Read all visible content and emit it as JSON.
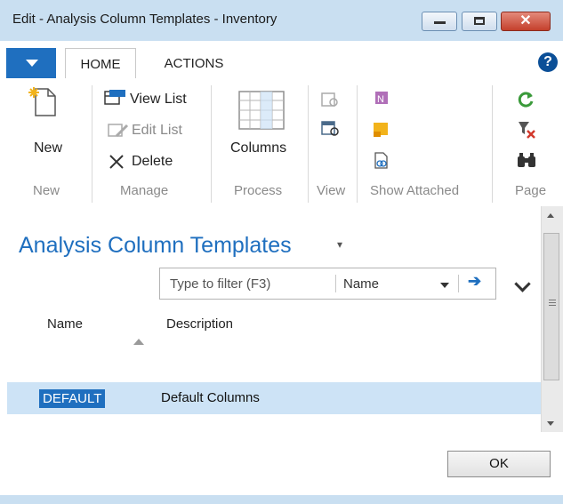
{
  "window": {
    "title": "Edit - Analysis Column Templates - Inventory",
    "close_glyph": "✕"
  },
  "ribbon": {
    "tabs": [
      {
        "label": "HOME",
        "selected": true
      },
      {
        "label": "ACTIONS",
        "selected": false
      }
    ],
    "help_glyph": "?",
    "groups": {
      "new": {
        "label": "New",
        "new_button": "New"
      },
      "manage": {
        "label": "Manage",
        "view_list": "View List",
        "edit_list": "Edit List",
        "delete": "Delete"
      },
      "process": {
        "label": "Process",
        "columns": "Columns"
      },
      "view": {
        "label": "View"
      },
      "show_attached": {
        "label": "Show Attached"
      },
      "page": {
        "label": "Page"
      }
    }
  },
  "page": {
    "title": "Analysis Column Templates",
    "title_arrow": "▾",
    "filter": {
      "placeholder": "Type to filter (F3)",
      "field": "Name",
      "go_glyph": "➔"
    },
    "columns": [
      "Name",
      "Description"
    ],
    "rows": [
      {
        "name": "DEFAULT",
        "description": "Default Columns",
        "selected": true
      }
    ]
  },
  "footer": {
    "ok_label": "OK"
  },
  "colors": {
    "accent": "#1f6fbf",
    "title_bar": "#c9dff1",
    "selected_row": "#cde3f6"
  }
}
